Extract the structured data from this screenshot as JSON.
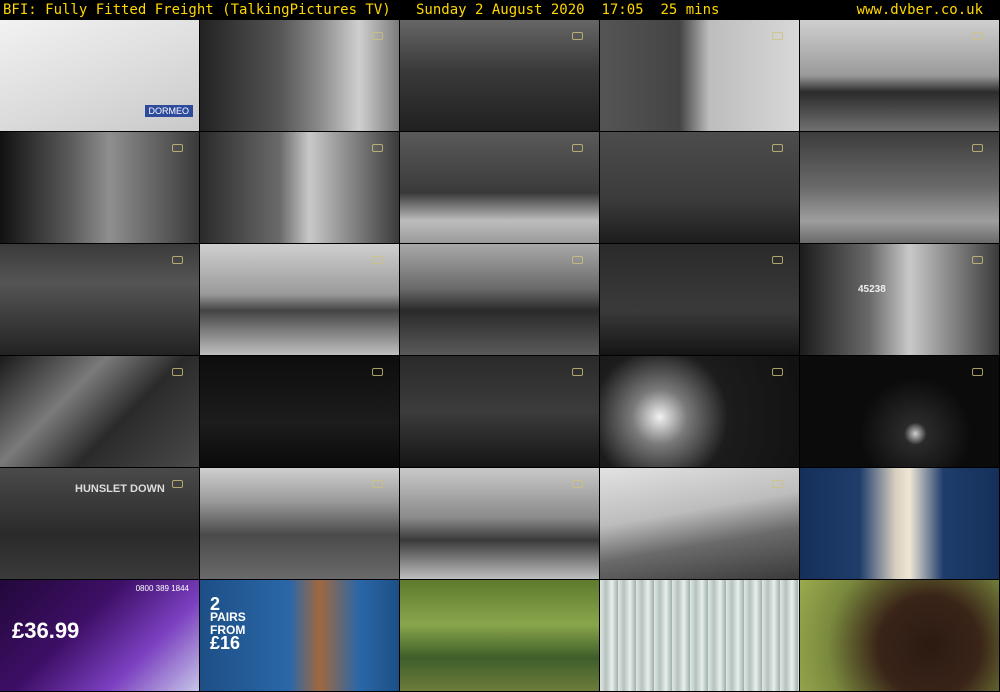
{
  "header": {
    "title": "BFI: Fully Fitted Freight (TalkingPictures TV)   Sunday 2 August 2020  17:05  25 mins",
    "site": "www.dvber.co.uk"
  },
  "colors": {
    "header_text": "#ffd700",
    "background": "#000000"
  },
  "thumbnails": [
    {
      "scene": "",
      "watermark": false
    },
    {
      "scene": "",
      "watermark": true
    },
    {
      "scene": "",
      "watermark": true
    },
    {
      "scene": "",
      "watermark": true
    },
    {
      "scene": "",
      "watermark": true
    },
    {
      "scene": "",
      "watermark": true
    },
    {
      "scene": "",
      "watermark": true
    },
    {
      "scene": "",
      "watermark": true
    },
    {
      "scene": "",
      "watermark": true
    },
    {
      "scene": "",
      "watermark": true
    },
    {
      "scene": "",
      "watermark": true
    },
    {
      "scene": "",
      "watermark": true
    },
    {
      "scene": "",
      "watermark": true
    },
    {
      "scene": "",
      "watermark": true
    },
    {
      "scene": "45238",
      "watermark": true
    },
    {
      "scene": "",
      "watermark": true
    },
    {
      "scene": "",
      "watermark": true
    },
    {
      "scene": "",
      "watermark": true
    },
    {
      "scene": "",
      "watermark": true
    },
    {
      "scene": "",
      "watermark": true
    },
    {
      "scene": "HUNSLET DOWN",
      "watermark": true
    },
    {
      "scene": "",
      "watermark": true
    },
    {
      "scene": "",
      "watermark": true
    },
    {
      "scene": "",
      "watermark": true
    },
    {
      "scene": "",
      "watermark": false
    },
    {
      "scene": "",
      "watermark": false
    },
    {
      "scene": "",
      "watermark": false
    },
    {
      "scene": "",
      "watermark": false
    },
    {
      "scene": "",
      "watermark": false
    },
    {
      "scene": "",
      "watermark": false
    }
  ],
  "overlays": {
    "dormeo": "DORMEO",
    "ad1_price": "£36.99",
    "ad1_phone": "0800 389 1844",
    "ad2_count": "2",
    "ad2_text": "PAIRS FROM",
    "ad2_price": "£16",
    "loco_number": "45238",
    "wagon_text": "HUNSLET DOWN"
  }
}
